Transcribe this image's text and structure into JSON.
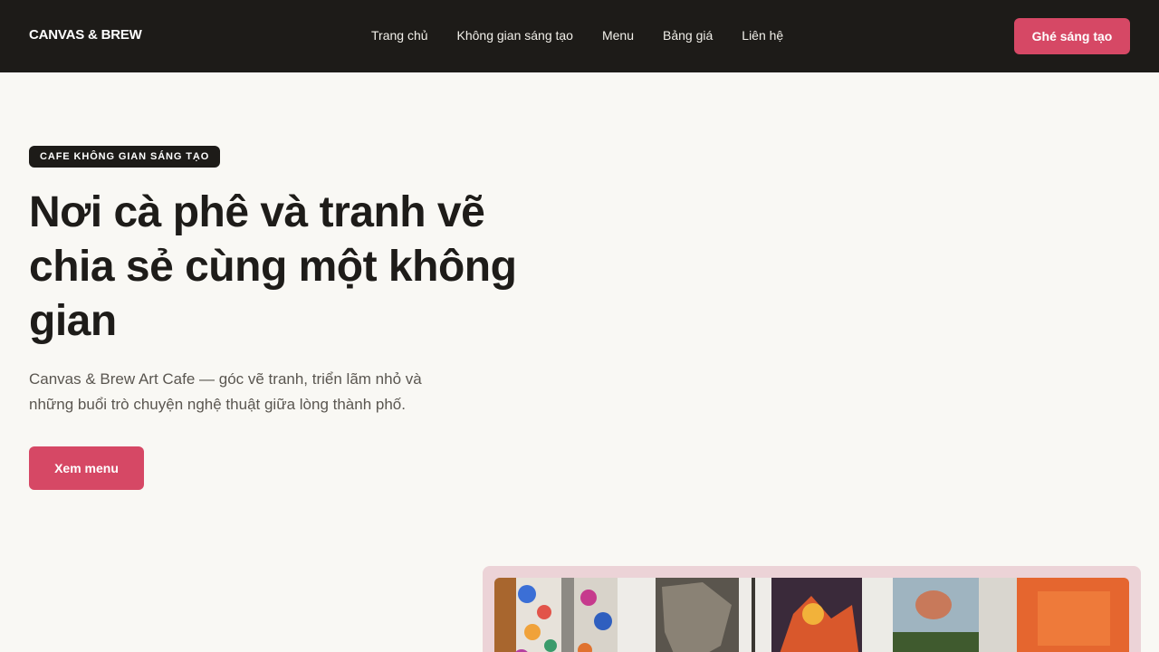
{
  "header": {
    "brand": "CANVAS & BREW",
    "nav": [
      "Trang chủ",
      "Không gian sáng tạo",
      "Menu",
      "Bảng giá",
      "Liên hệ"
    ],
    "cta": "Ghé sáng tạo"
  },
  "hero": {
    "badge": "CAFE KHÔNG GIAN SÁNG TẠO",
    "title": "Nơi cà phê và tranh vẽ chia sẻ cùng một không gian",
    "subtitle": "Canvas & Brew Art Cafe — góc vẽ tranh, triển lãm nhỏ và những buổi trò chuyện nghệ thuật giữa lòng thành phố.",
    "cta": "Xem menu"
  },
  "gallery": {
    "accent": "#d64865",
    "frame_color": "#ecd3d7"
  }
}
